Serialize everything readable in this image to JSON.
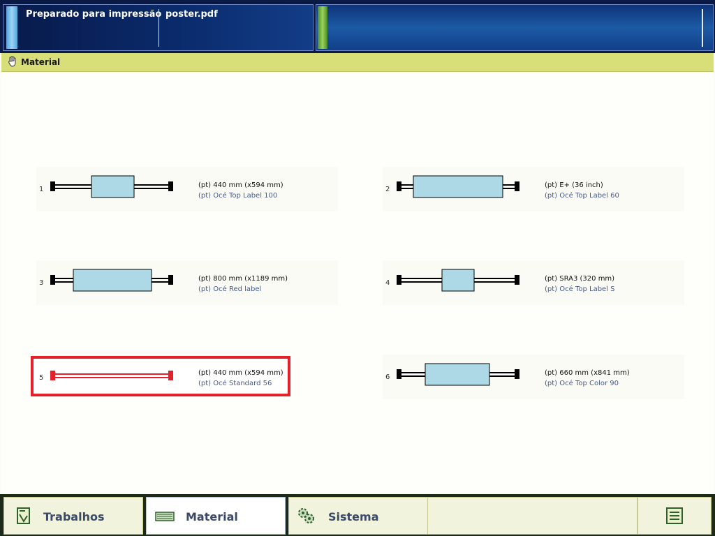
{
  "header": {
    "status": "Preparado para impressão",
    "file": "poster.pdf"
  },
  "section": {
    "title": "Material"
  },
  "rolls": [
    {
      "num": "1",
      "line1": "(pt) 440 mm (x594 mm)",
      "line2": "(pt) Océ Top Label 100",
      "selected": false
    },
    {
      "num": "2",
      "line1": "(pt) E+ (36 inch)",
      "line2": "(pt) Océ Top Label 60",
      "selected": false
    },
    {
      "num": "3",
      "line1": "(pt) 800 mm (x1189 mm)",
      "line2": "(pt) Océ Red label",
      "selected": false
    },
    {
      "num": "4",
      "line1": "(pt) SRA3 (320 mm)",
      "line2": "(pt) Océ Top Label S",
      "selected": false
    },
    {
      "num": "5",
      "line1": "(pt) 440 mm (x594 mm)",
      "line2": "(pt) Océ Standard 56",
      "selected": true
    },
    {
      "num": "6",
      "line1": "(pt) 660 mm (x841 mm)",
      "line2": "(pt) Océ Top Color 90",
      "selected": false
    }
  ],
  "tabs": {
    "jobs": "Trabalhos",
    "material": "Material",
    "system": "Sistema"
  },
  "icons": {
    "section": "material-hand-icon",
    "jobs": "jobs-document-icon",
    "material": "material-rolls-icon",
    "system": "system-gears-icon",
    "menu": "menu-list-icon"
  },
  "colors": {
    "accent_selected": "#e3212b",
    "section_bar": "#d9df78",
    "roll_media": "#add8e6"
  }
}
